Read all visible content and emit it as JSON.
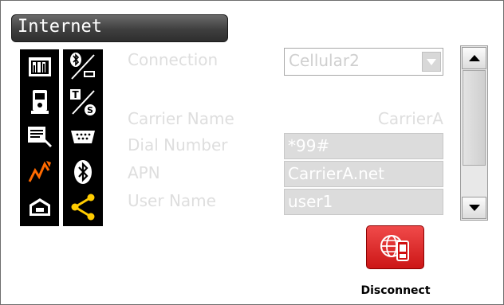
{
  "window": {
    "title": "Internet"
  },
  "left_icons": [
    {
      "name": "settings-tabs-icon",
      "accent": "#ffffff"
    },
    {
      "name": "instrument-icon",
      "accent": "#ffffff"
    },
    {
      "name": "document-edit-icon",
      "accent": "#ffffff"
    },
    {
      "name": "signal-zigzag-icon",
      "accent": "#ff6a00"
    },
    {
      "name": "box-tool-icon",
      "accent": "#ffffff"
    }
  ],
  "right_icons": [
    {
      "name": "bluetooth-serial-icon",
      "accent": "#ffffff"
    },
    {
      "name": "t-s-toggle-icon",
      "accent": "#ffffff"
    },
    {
      "name": "serial-port-icon",
      "accent": "#ffffff"
    },
    {
      "name": "bluetooth-icon",
      "accent": "#ffffff"
    },
    {
      "name": "share-network-icon",
      "accent": "#ffcc00"
    }
  ],
  "form": {
    "connection_label": "Connection",
    "connection_value": "Cellular2",
    "carrier_label": "Carrier Name",
    "carrier_value": "CarrierA",
    "dial_label": "Dial Number",
    "dial_value": "*99#",
    "apn_label": "APN",
    "apn_value": "CarrierA.net",
    "user_label": "User Name",
    "user_value": "user1"
  },
  "actions": {
    "disconnect_label": "Disconnect"
  },
  "colors": {
    "disconnect_bg": "#e02020",
    "title_bg": "#3f3f3f",
    "disabled_text": "#dedede"
  }
}
